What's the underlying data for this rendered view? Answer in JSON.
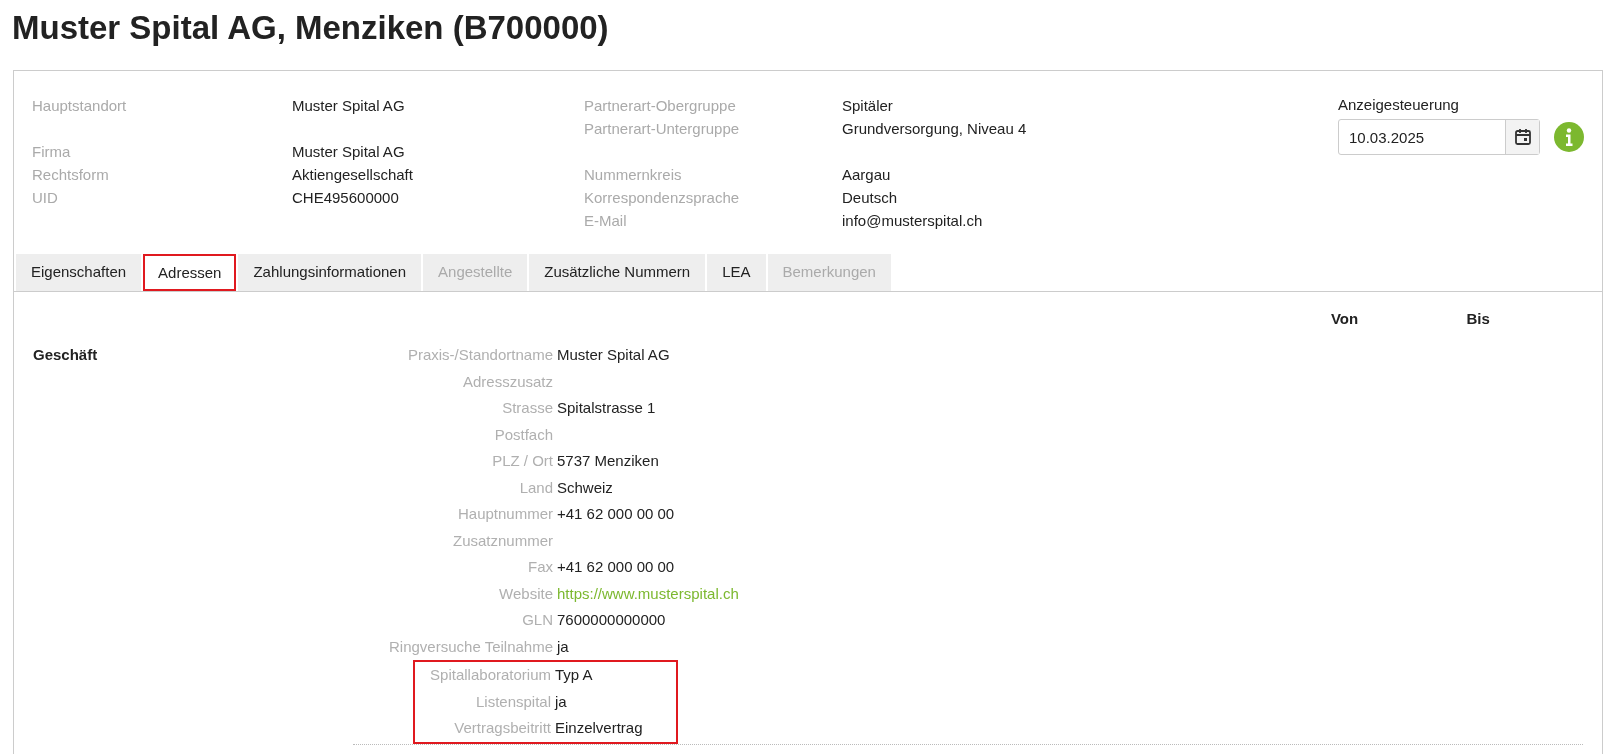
{
  "title": "Muster Spital AG, Menziken (B700000)",
  "header": {
    "left": [
      [
        {
          "label": "Hauptstandort",
          "value": "Muster Spital AG"
        }
      ],
      [
        {
          "label": "Firma",
          "value": "Muster Spital AG"
        },
        {
          "label": "Rechtsform",
          "value": "Aktiengesellschaft"
        },
        {
          "label": "UID",
          "value": "CHE495600000"
        }
      ]
    ],
    "right": [
      [
        {
          "label": "Partnerart-Obergruppe",
          "value": "Spitäler"
        },
        {
          "label": "Partnerart-Untergruppe",
          "value": "Grundversorgung, Niveau 4"
        }
      ],
      [
        {
          "label": "Nummernkreis",
          "value": "Aargau"
        },
        {
          "label": "Korrespondenzsprache",
          "value": "Deutsch"
        },
        {
          "label": "E-Mail",
          "value": "info@musterspital.ch"
        }
      ]
    ],
    "display_control": {
      "label": "Anzeigesteuerung",
      "value": "10.03.2025"
    }
  },
  "tabs": [
    {
      "label": "Eigenschaften",
      "selected": false,
      "disabled": false,
      "highlighted": false
    },
    {
      "label": "Adressen",
      "selected": true,
      "disabled": false,
      "highlighted": true
    },
    {
      "label": "Zahlungsinformationen",
      "selected": false,
      "disabled": false,
      "highlighted": false
    },
    {
      "label": "Angestellte",
      "selected": false,
      "disabled": true,
      "highlighted": false
    },
    {
      "label": "Zusätzliche Nummern",
      "selected": false,
      "disabled": false,
      "highlighted": false
    },
    {
      "label": "LEA",
      "selected": false,
      "disabled": false,
      "highlighted": false
    },
    {
      "label": "Bemerkungen",
      "selected": false,
      "disabled": true,
      "highlighted": false
    }
  ],
  "columns": [
    "Von",
    "Bis"
  ],
  "section": {
    "title": "Geschäft",
    "fields": [
      {
        "label": "Praxis-/Standortname",
        "value": "Muster Spital AG",
        "kind": "text",
        "highlighted": false
      },
      {
        "label": "Adresszusatz",
        "highlighted": false
      },
      {
        "label": "Strasse",
        "value": "Spitalstrasse 1",
        "kind": "text",
        "highlighted": false
      },
      {
        "label": "Postfach",
        "highlighted": false
      },
      {
        "label": "PLZ / Ort",
        "value": "5737 Menziken",
        "kind": "text",
        "highlighted": false
      },
      {
        "label": "Land",
        "value": "Schweiz",
        "kind": "text",
        "highlighted": false
      },
      {
        "label": "Hauptnummer",
        "value": "+41 62 000 00 00",
        "kind": "text",
        "highlighted": false
      },
      {
        "label": "Zusatznummer",
        "highlighted": false
      },
      {
        "label": "Fax",
        "value": "+41 62 000 00 00",
        "kind": "text",
        "highlighted": false
      },
      {
        "label": "Website",
        "value": "https://www.musterspital.ch",
        "kind": "link",
        "highlighted": false
      },
      {
        "label": "GLN",
        "value": "7600000000000",
        "kind": "text",
        "highlighted": false
      },
      {
        "label": "Ringversuche Teilnahme",
        "value": "ja",
        "kind": "text",
        "highlighted": false
      },
      {
        "label": "Spitallaboratorium",
        "value": "Typ A",
        "kind": "text",
        "highlighted": true
      },
      {
        "label": "Listenspital",
        "value": "ja",
        "kind": "text",
        "highlighted": true
      },
      {
        "label": "Vertragsbeitritt",
        "value": "Einzelvertrag",
        "kind": "text",
        "highlighted": true
      }
    ]
  }
}
